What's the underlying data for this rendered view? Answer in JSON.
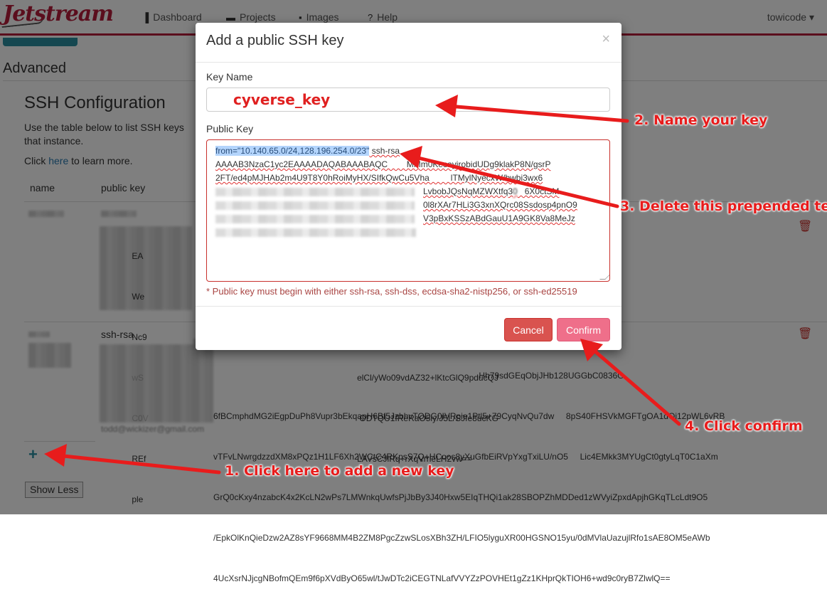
{
  "nav": {
    "brand": "Jetstream",
    "items": [
      {
        "label": "Dashboard",
        "icon": "bar-chart-icon",
        "glyph": "▐"
      },
      {
        "label": "Projects",
        "icon": "folder-icon",
        "glyph": "▬"
      },
      {
        "label": "Images",
        "icon": "floppy-icon",
        "glyph": "▪"
      },
      {
        "label": "Help",
        "icon": "question-icon",
        "glyph": "?"
      }
    ],
    "user": "towicode ▾"
  },
  "page": {
    "section_title": "Advanced",
    "ssh_title": "SSH Configuration",
    "ssh_desc": "Use the table below to list SSH keys that instance.",
    "learn_prefix": "Click ",
    "learn_link": "here",
    "learn_suffix": " to learn more.",
    "table_headers": {
      "name": "name",
      "public_key": "public key"
    },
    "row1_key_lines": [
      "             EA                                                                                          Y2QP9rpnAyaNKGrIn9ANQ6cOHCCp9",
      "             We                                                                                          jHO1T2EsPSWN1yTuquGU1qBJ/2eR",
      "             Nc9                                                                                         r6sXwvEbTYtZ+e7lwx1AO6qoF0Lv3Y",
      "             wS                                                                                          elCl/yWo09vdAZ32+lKtcGlQ9pducQJ",
      "             C0V                                                                                         ODTQU1fReRaO5ly/J5L/SJfe8ucKG",
      "             REf                                                                                         LAVsCJiRq+rXqVrrieLH2vw==",
      "             ple"
    ],
    "row2_ssh_rsa": "ssh-rsa",
    "row2_key_lines": [
      "                                                                                                                Hh79sdGEqObjJHb128UGGbC0836G",
      "6fBCmphdMG2iEgpDuPh8Vupr3bEkqapH6Bf5JzbhvTODG0IVRpie1Ptl5+79CyqNvQu7dw     8pS40FHSVkMGFTgOA1dOj12pWL6yRB",
      "vTFvLNwrgdzzdXM8xPQz1H1LF6Xh2WCtC4RKpsS7Q+HCoos8yXuGfbEiRVpYxgTxiLU/nO5     Lic4EMkk3MYUgCt0gtyLqT0C1aXm",
      "GrQ0cKxy4nzabcK4x2KcLN2wPs7LMWnkqUwfsPjJbBy3J40Hxw5EIqTHQi1ak28SBOPZhMDDed1zWVyiZpxdApjhGKqTLcLdt9O5",
      "/EpkOlKnQieDzw2AZ8sYF9668MM4B2ZM8PgcZzwSLosXBh3ZH/LFIO5lyguXR00HGSNO15yu/0dMVlaUazujlRfo1sAE8OM5eAWb",
      "4UcXsrNJjcgNBofmQEm9f6pXVdByO65wl/tJwDTc2iCEGTNLafVVYZzPOVHEt1gZz1KHprQkTIOH6+wd9c0ryB7ZlwlQ=="
    ],
    "row2_email": "todd@wickizer@gmail.com",
    "show_less": "Show Less"
  },
  "modal": {
    "title": "Add a public SSH key",
    "close": "×",
    "key_name_label": "Key Name",
    "key_name_value": "cyverse_key",
    "public_key_label": "Public Key",
    "public_key_selected": "from=\"10.140.65.0/24,128.196.254.0/23\"",
    "public_key_lines": [
      " ssh-rsa",
      "AAAAB3NzaC1yc2EAAAADAQABAAABAQC        MMm0KesayirobidUDg9klakP8N/gsrP",
      "2FT/ed4pMJHAb2m4U9T8Y0hRoiMyHX/SIfkQwCu5Vha         lTMylNyecxW/bwbi3wx6",
      "                                                                                                                                  LvbobJQsNqMZWXtfq                 6X0ctSM",
      "                                                                                                                                  0l8rXAr7HLi3G3xnXQrc08Ssdosp4pnO9",
      "                                                                                                                                  V3pBxKSSzABdGauU1A9GK8Va8MeJz"
    ],
    "error": "* Public key must begin with either ssh-rsa, ssh-dss, ecdsa-sha2-nistp256, or ssh-ed25519",
    "cancel": "Cancel",
    "confirm": "Confirm"
  },
  "annotations": {
    "step1": "1. Click here to add a new key",
    "step2": "2. Name your key",
    "step3": "3. Delete this prepended text",
    "step4": "4. Click confirm"
  },
  "colors": {
    "brand": "#b71c3b",
    "accent": "#2a8fa0",
    "danger": "#d9534f",
    "confirm": "#ef6f8a",
    "annotation": "#e81c1c"
  }
}
